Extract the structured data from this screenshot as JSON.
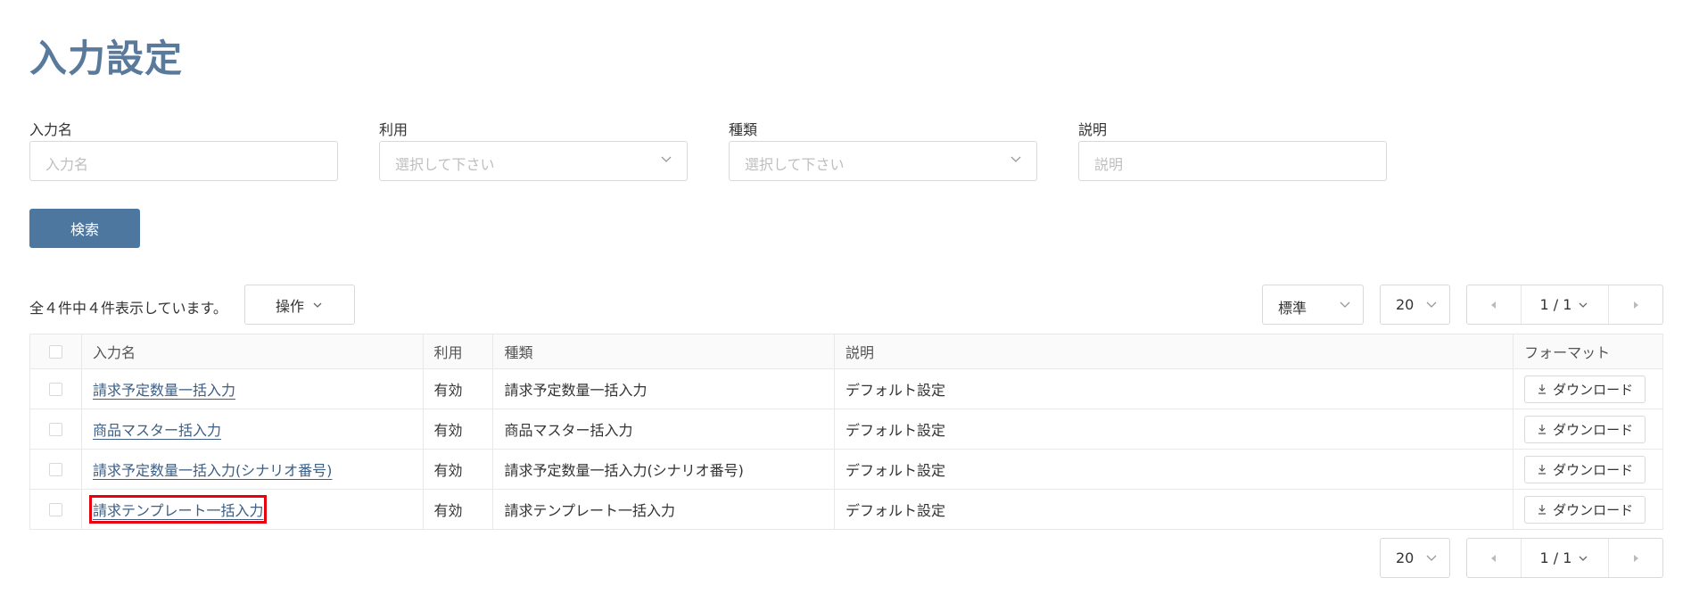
{
  "page": {
    "title": "入力設定"
  },
  "filters": {
    "name": {
      "label": "入力名",
      "placeholder": "入力名"
    },
    "use": {
      "label": "利用",
      "placeholder": "選択して下さい"
    },
    "type": {
      "label": "種類",
      "placeholder": "選択して下さい"
    },
    "description": {
      "label": "説明",
      "placeholder": "説明"
    },
    "search_label": "検索"
  },
  "toolbar": {
    "summary": "全４件中４件表示しています。",
    "operations_label": "操作",
    "view_select": "標準",
    "page_size": "20",
    "page_indicator": "1 / 1"
  },
  "table": {
    "columns": [
      "入力名",
      "利用",
      "種類",
      "説明",
      "フォーマット"
    ],
    "rows": [
      {
        "name": "請求予定数量一括入力",
        "use": "有効",
        "type": "請求予定数量一括入力",
        "description": "デフォルト設定",
        "format": "ダウンロード"
      },
      {
        "name": "商品マスター括入力",
        "use": "有効",
        "type": "商品マスター括入力",
        "description": "デフォルト設定",
        "format": "ダウンロード"
      },
      {
        "name": "請求予定数量一括入力(シナリオ番号)",
        "use": "有効",
        "type": "請求予定数量一括入力(シナリオ番号)",
        "description": "デフォルト設定",
        "format": "ダウンロード"
      },
      {
        "name": "請求テンプレート一括入力",
        "use": "有効",
        "type": "請求テンプレート一括入力",
        "description": "デフォルト設定",
        "format": "ダウンロード"
      }
    ]
  },
  "footer": {
    "page_size": "20",
    "page_indicator": "1 / 1"
  },
  "colors": {
    "accent": "#4e77a0",
    "title": "#5a7a9c",
    "link": "#3d5f85",
    "highlight": "#e8000c"
  }
}
